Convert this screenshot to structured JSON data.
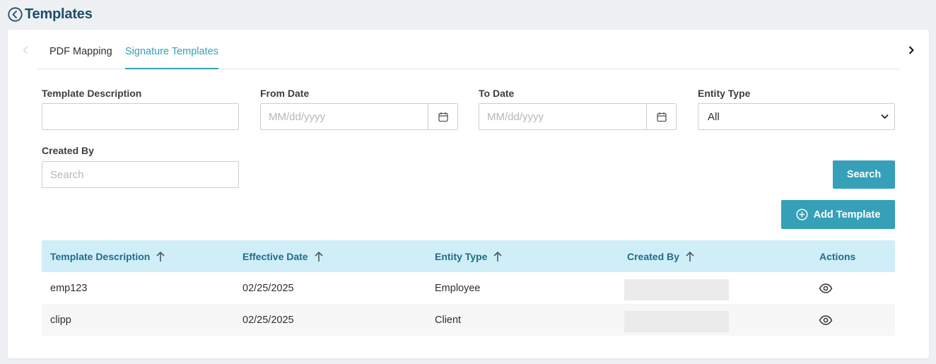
{
  "header": {
    "title": "Templates",
    "back_icon": "chevron-left-circle-icon"
  },
  "tabs": [
    {
      "label": "PDF Mapping",
      "active": false
    },
    {
      "label": "Signature Templates",
      "active": true
    }
  ],
  "filters": {
    "template_description": {
      "label": "Template Description",
      "value": "",
      "placeholder": ""
    },
    "from_date": {
      "label": "From Date",
      "placeholder": "MM/dd/yyyy"
    },
    "to_date": {
      "label": "To Date",
      "placeholder": "MM/dd/yyyy"
    },
    "entity_type": {
      "label": "Entity Type",
      "selected": "All"
    },
    "created_by": {
      "label": "Created By",
      "placeholder": "Search"
    }
  },
  "buttons": {
    "search": "Search",
    "add_template": "Add Template"
  },
  "table": {
    "columns": [
      "Template Description",
      "Effective Date",
      "Entity Type",
      "Created By",
      "Actions"
    ],
    "rows": [
      {
        "description": "emp123",
        "effective_date": "02/25/2025",
        "entity_type": "Employee",
        "created_by": "",
        "action_icon": "eye-icon"
      },
      {
        "description": "clipp",
        "effective_date": "02/25/2025",
        "entity_type": "Client",
        "created_by": "",
        "action_icon": "eye-icon"
      }
    ]
  },
  "colors": {
    "accent": "#35a0b8",
    "title": "#1e4e68",
    "table_header_bg": "#d0eef8",
    "table_header_text": "#1f6e84"
  }
}
